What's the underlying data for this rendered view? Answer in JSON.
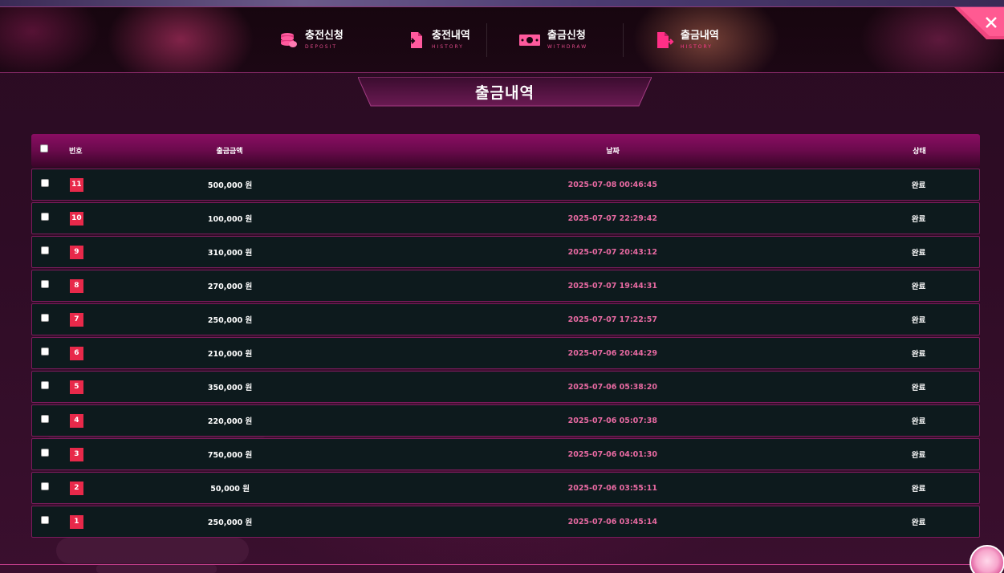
{
  "nav": {
    "items": [
      {
        "label": "충전신청",
        "sub": "DEPOSIT",
        "icon": "coins-icon"
      },
      {
        "label": "충전내역",
        "sub": "HISTORY",
        "icon": "document-in-icon"
      },
      {
        "label": "출금신청",
        "sub": "WITHDRAW",
        "icon": "banknote-icon"
      },
      {
        "label": "출금내역",
        "sub": "HISTORY",
        "icon": "document-out-icon"
      }
    ],
    "active_index": 3
  },
  "page": {
    "title": "출금내역"
  },
  "table": {
    "headers": {
      "no": "번호",
      "amount": "출금금액",
      "date": "날짜",
      "status": "상태"
    },
    "rows": [
      {
        "no": "11",
        "amount": "500,000 원",
        "date": "2025-07-08 00:46:45",
        "status": "완료"
      },
      {
        "no": "10",
        "amount": "100,000 원",
        "date": "2025-07-07 22:29:42",
        "status": "완료"
      },
      {
        "no": "9",
        "amount": "310,000 원",
        "date": "2025-07-07 20:43:12",
        "status": "완료"
      },
      {
        "no": "8",
        "amount": "270,000 원",
        "date": "2025-07-07 19:44:31",
        "status": "완료"
      },
      {
        "no": "7",
        "amount": "250,000 원",
        "date": "2025-07-07 17:22:57",
        "status": "완료"
      },
      {
        "no": "6",
        "amount": "210,000 원",
        "date": "2025-07-06 20:44:29",
        "status": "완료"
      },
      {
        "no": "5",
        "amount": "350,000 원",
        "date": "2025-07-06 05:38:20",
        "status": "완료"
      },
      {
        "no": "4",
        "amount": "220,000 원",
        "date": "2025-07-06 05:07:38",
        "status": "완료"
      },
      {
        "no": "3",
        "amount": "750,000 원",
        "date": "2025-07-06 04:01:30",
        "status": "완료"
      },
      {
        "no": "2",
        "amount": "50,000 원",
        "date": "2025-07-06 03:55:11",
        "status": "완료"
      },
      {
        "no": "1",
        "amount": "250,000 원",
        "date": "2025-07-06 03:45:14",
        "status": "완료"
      }
    ]
  },
  "colors": {
    "accent": "#e8294a",
    "date_text": "#e86aa2",
    "header_bg": "#8a0d63",
    "row_bg": "#0d1a1d",
    "row_border": "#7a1c5c"
  }
}
